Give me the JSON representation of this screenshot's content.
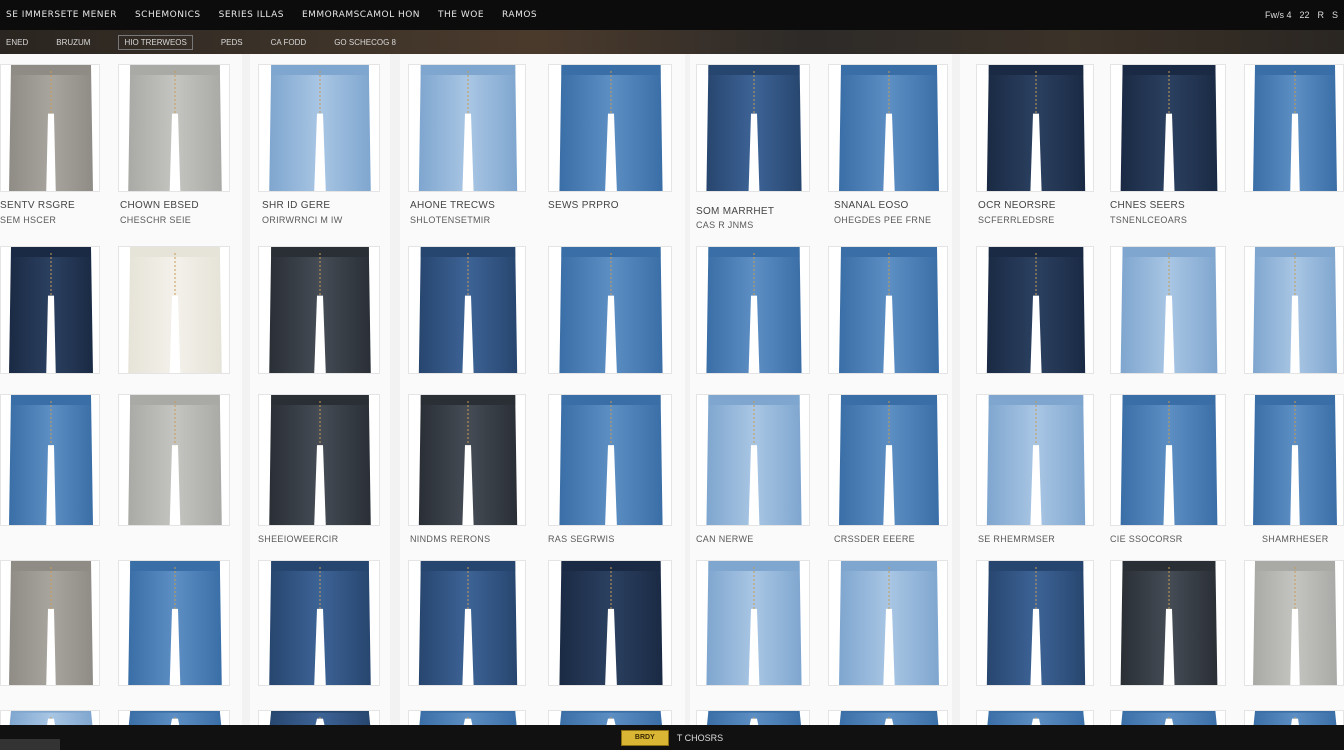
{
  "topbar": {
    "items": [
      "SE IMMERSETE MENER",
      "SCHEMONICS",
      "SERIES ILLAS",
      "EMMORAMSCAMOL HON",
      "THE WOE",
      "RAMOS"
    ],
    "right": [
      "Fw/s 4",
      "22",
      "R",
      "S"
    ]
  },
  "subbar": {
    "items": [
      "ENED",
      "BRUZUM",
      "HIO TRERWEOS",
      "PEDS",
      "CA FODD",
      "GO SCHECOG 8"
    ]
  },
  "captions": {
    "r1": [
      [
        "SENTV RSGRE",
        "SEM HSCER"
      ],
      [
        "CHOWN EBSED",
        "CHESCHR SEIE"
      ],
      [
        "SHR ID GERE",
        "ORIRWRNCI M IW"
      ],
      [
        "AHONE TRECWS",
        "SHLOTENSETMIR"
      ],
      [
        "SEWS PRPRO",
        ""
      ],
      [
        "SOM MARRHET",
        "CAS R JNMS"
      ],
      [
        "SNANAL EOSO",
        "OHEGDES PEE FRNE"
      ],
      [
        "OCR NEORSRE",
        "SCFERRLEDSRE"
      ],
      [
        "CHNES SEERS",
        "TSNENLCEOARS"
      ]
    ],
    "r3": [
      "SHEEIOWEERCIR",
      "NINDMS RERONS",
      "RAS SEGRWIS",
      "CAN NERWE",
      "CRSSDER EEERE",
      "SE RHEMRMSER",
      "CIE SSOCORSR",
      "SHAMRHESER"
    ]
  },
  "bottombar": {
    "logo": "BRDY",
    "text": "T CHOSRS"
  },
  "colors": {
    "dark_navy": "#1e2b45",
    "mid_blue": "#3b6fa8",
    "light_blue": "#8fb4d8",
    "grey": "#9a9a9a",
    "ecru": "#e8e6dc"
  },
  "products": [
    {
      "row": 0,
      "col": 0,
      "shade": "grey"
    },
    {
      "row": 0,
      "col": 1,
      "shade": "lightgrey"
    },
    {
      "row": 0,
      "col": 2,
      "shade": "light"
    },
    {
      "row": 0,
      "col": 3,
      "shade": "light"
    },
    {
      "row": 0,
      "col": 4,
      "shade": "dark"
    },
    {
      "row": 0,
      "col": 5,
      "shade": "mid"
    },
    {
      "row": 0,
      "col": 6,
      "shade": "mid"
    },
    {
      "row": 0,
      "col": 7,
      "shade": "navy"
    },
    {
      "row": 0,
      "col": 8,
      "shade": "navy"
    },
    {
      "row": 0,
      "col": 9,
      "shade": "mid"
    }
  ]
}
